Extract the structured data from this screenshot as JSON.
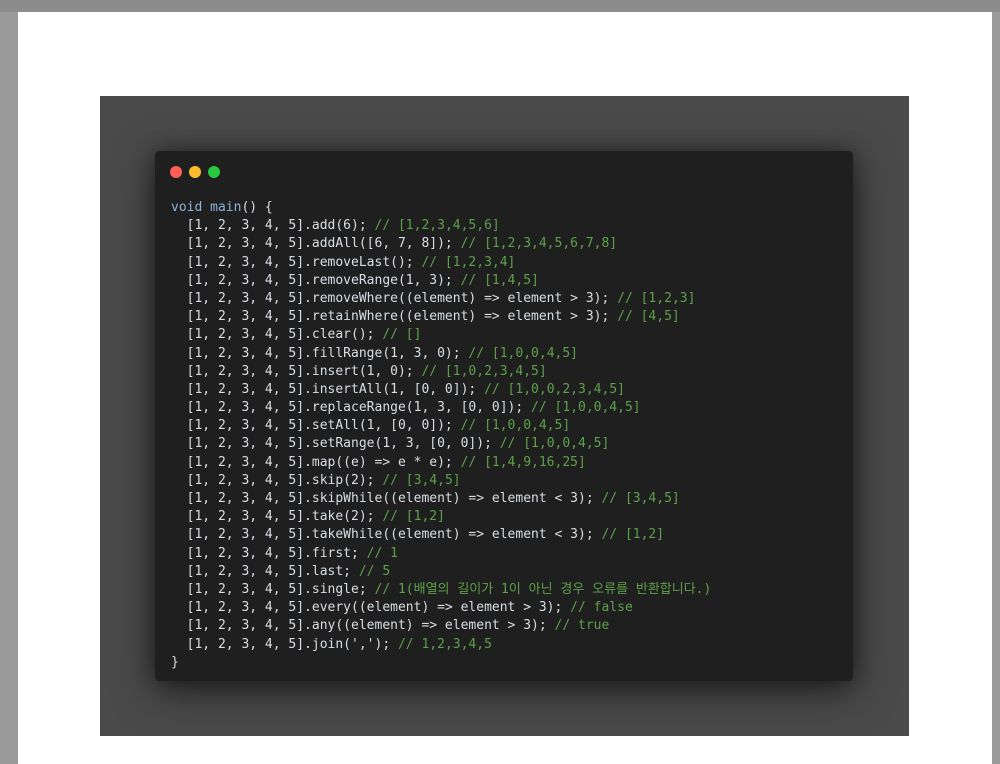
{
  "colors": {
    "background_outer": "#9a9a9a",
    "paper": "#ffffff",
    "frame": "#4a4a4a",
    "window": "#1f1f1f",
    "keyword": "#8ab4d8",
    "comment": "#5da14a",
    "text": "#d8dee4",
    "dot_red": "#ff5f56",
    "dot_yellow": "#ffbd2e",
    "dot_green": "#27c93f"
  },
  "window_dots": [
    "red-dot-icon",
    "yellow-dot-icon",
    "green-dot-icon"
  ],
  "code": {
    "header": {
      "keyword": "void",
      "function": "main",
      "rest": "() {"
    },
    "lines": [
      {
        "code": "  [1, 2, 3, 4, 5].add(6); ",
        "comment": "// [1,2,3,4,5,6]"
      },
      {
        "code": "  [1, 2, 3, 4, 5].addAll([6, 7, 8]); ",
        "comment": "// [1,2,3,4,5,6,7,8]"
      },
      {
        "code": "  [1, 2, 3, 4, 5].removeLast(); ",
        "comment": "// [1,2,3,4]"
      },
      {
        "code": "  [1, 2, 3, 4, 5].removeRange(1, 3); ",
        "comment": "// [1,4,5]"
      },
      {
        "code": "  [1, 2, 3, 4, 5].removeWhere((element) => element > 3); ",
        "comment": "// [1,2,3]"
      },
      {
        "code": "  [1, 2, 3, 4, 5].retainWhere((element) => element > 3); ",
        "comment": "// [4,5]"
      },
      {
        "code": "  [1, 2, 3, 4, 5].clear(); ",
        "comment": "// []"
      },
      {
        "code": "  [1, 2, 3, 4, 5].fillRange(1, 3, 0); ",
        "comment": "// [1,0,0,4,5]"
      },
      {
        "code": "  [1, 2, 3, 4, 5].insert(1, 0); ",
        "comment": "// [1,0,2,3,4,5]"
      },
      {
        "code": "  [1, 2, 3, 4, 5].insertAll(1, [0, 0]); ",
        "comment": "// [1,0,0,2,3,4,5]"
      },
      {
        "code": "  [1, 2, 3, 4, 5].replaceRange(1, 3, [0, 0]); ",
        "comment": "// [1,0,0,4,5]"
      },
      {
        "code": "  [1, 2, 3, 4, 5].setAll(1, [0, 0]); ",
        "comment": "// [1,0,0,4,5]"
      },
      {
        "code": "  [1, 2, 3, 4, 5].setRange(1, 3, [0, 0]); ",
        "comment": "// [1,0,0,4,5]"
      },
      {
        "code": "  [1, 2, 3, 4, 5].map((e) => e * e); ",
        "comment": "// [1,4,9,16,25]"
      },
      {
        "code": "  [1, 2, 3, 4, 5].skip(2); ",
        "comment": "// [3,4,5]"
      },
      {
        "code": "  [1, 2, 3, 4, 5].skipWhile((element) => element < 3); ",
        "comment": "// [3,4,5]"
      },
      {
        "code": "  [1, 2, 3, 4, 5].take(2); ",
        "comment": "// [1,2]"
      },
      {
        "code": "  [1, 2, 3, 4, 5].takeWhile((element) => element < 3); ",
        "comment": "// [1,2]"
      },
      {
        "code": "  [1, 2, 3, 4, 5].first; ",
        "comment": "// 1"
      },
      {
        "code": "  [1, 2, 3, 4, 5].last; ",
        "comment": "// 5"
      },
      {
        "code": "  [1, 2, 3, 4, 5].single; ",
        "comment": "// 1(배열의 길이가 1이 아닌 경우 오류를 반환합니다.)"
      },
      {
        "code": "  [1, 2, 3, 4, 5].every((element) => element > 3); ",
        "comment": "// false"
      },
      {
        "code": "  [1, 2, 3, 4, 5].any((element) => element > 3); ",
        "comment": "// true"
      },
      {
        "code": "  [1, 2, 3, 4, 5].join(','); ",
        "comment": "// 1,2,3,4,5"
      }
    ],
    "footer": "}"
  }
}
